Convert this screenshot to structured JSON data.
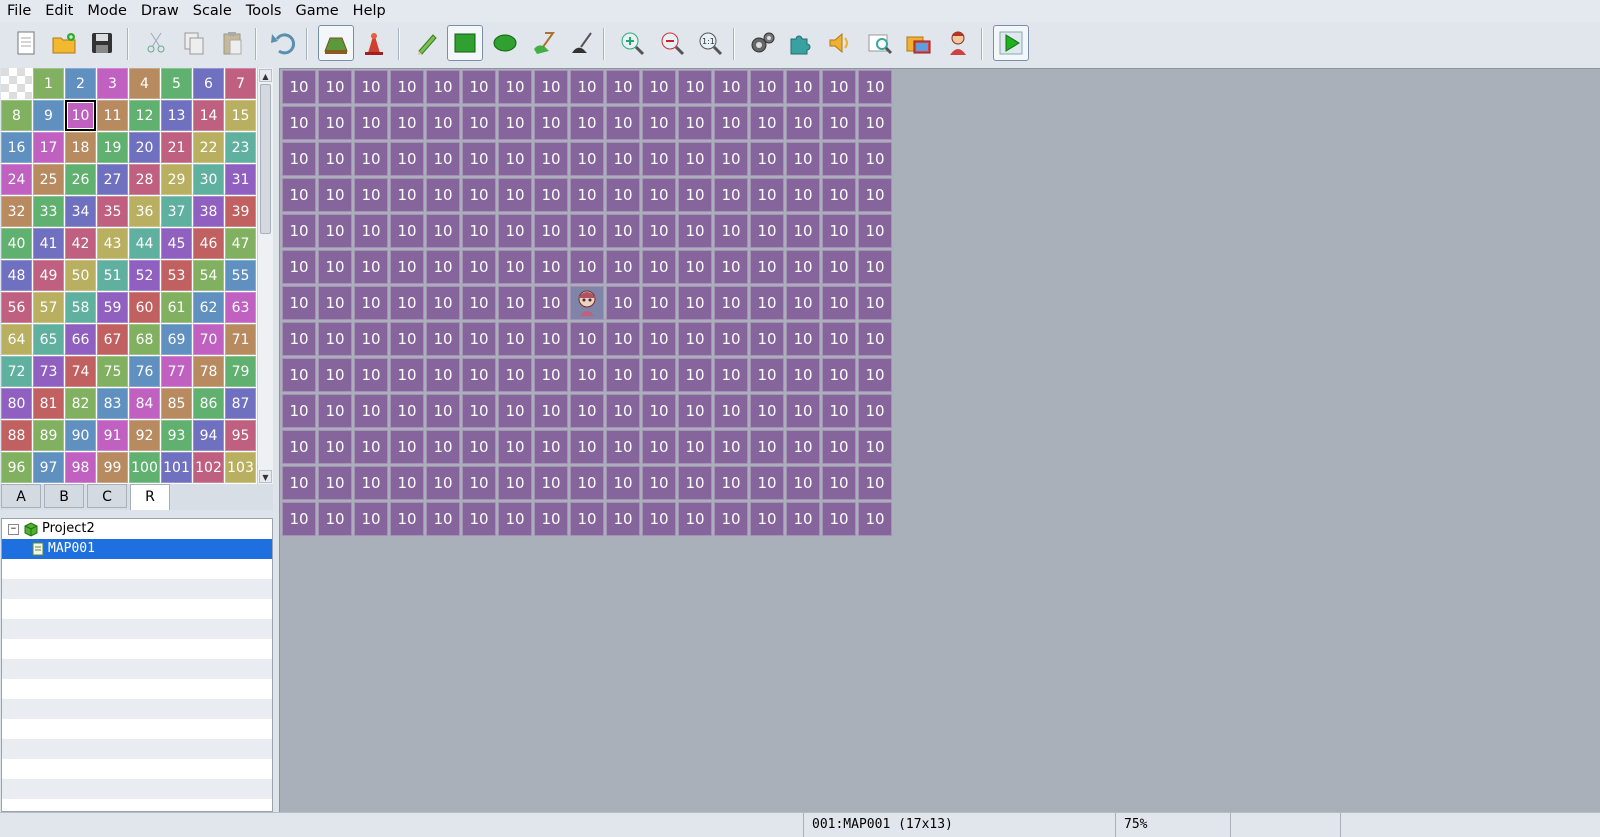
{
  "menu": [
    "File",
    "Edit",
    "Mode",
    "Draw",
    "Scale",
    "Tools",
    "Game",
    "Help"
  ],
  "toolbar": {
    "buttons": [
      {
        "name": "new-project-icon",
        "active": false
      },
      {
        "name": "open-project-icon",
        "active": false
      },
      {
        "name": "save-project-icon",
        "active": false
      },
      {
        "name": "cut-icon",
        "active": false
      },
      {
        "name": "copy-icon",
        "active": false
      },
      {
        "name": "paste-icon",
        "active": false
      },
      {
        "name": "undo-icon",
        "active": false
      },
      {
        "name": "map-mode-icon",
        "active": true
      },
      {
        "name": "event-mode-icon",
        "active": false
      },
      {
        "name": "pencil-icon",
        "active": false
      },
      {
        "name": "rectangle-icon",
        "active": true
      },
      {
        "name": "ellipse-icon",
        "active": false
      },
      {
        "name": "fill-icon",
        "active": false
      },
      {
        "name": "shadow-pen-icon",
        "active": false
      },
      {
        "name": "zoom-in-icon",
        "active": false
      },
      {
        "name": "zoom-out-icon",
        "active": false
      },
      {
        "name": "zoom-actual-icon",
        "active": false
      },
      {
        "name": "database-icon",
        "active": false
      },
      {
        "name": "plugin-manager-icon",
        "active": false
      },
      {
        "name": "sound-test-icon",
        "active": false
      },
      {
        "name": "event-search-icon",
        "active": false
      },
      {
        "name": "resource-manager-icon",
        "active": false
      },
      {
        "name": "character-generator-icon",
        "active": false
      },
      {
        "name": "playtest-icon",
        "active": true
      }
    ]
  },
  "palette": {
    "selected": 10,
    "tiles": [
      "1",
      "2",
      "3",
      "4",
      "5",
      "6",
      "7",
      "8",
      "9",
      "10",
      "11",
      "12",
      "13",
      "14",
      "15",
      "16",
      "17",
      "18",
      "19",
      "20",
      "21",
      "22",
      "23",
      "24",
      "25",
      "26",
      "27",
      "28",
      "29",
      "30",
      "31",
      "32",
      "33",
      "34",
      "35",
      "36",
      "37",
      "38",
      "39",
      "40",
      "41",
      "42",
      "43",
      "44",
      "45",
      "46",
      "47",
      "48",
      "49",
      "50",
      "51",
      "52",
      "53",
      "54",
      "55",
      "56",
      "57",
      "58",
      "59",
      "60",
      "61",
      "62",
      "63",
      "64",
      "65",
      "66",
      "67",
      "68",
      "69",
      "70",
      "71",
      "72",
      "73",
      "74",
      "75",
      "76",
      "77",
      "78",
      "79",
      "80",
      "81",
      "82",
      "83",
      "84",
      "85",
      "86",
      "87",
      "88",
      "89",
      "90",
      "91",
      "92",
      "93",
      "94",
      "95",
      "96",
      "97",
      "98",
      "99",
      "100",
      "101",
      "102",
      "103"
    ],
    "colors": [
      "#c06060",
      "#b88a60",
      "#b8b060",
      "#80b060",
      "#60b070",
      "#60b0a0",
      "#6090c0",
      "#7070c0",
      "#9060c0",
      "#c060c0",
      "#c06080"
    ],
    "tabs": [
      "A",
      "B",
      "C",
      "R"
    ],
    "active_tab": "R"
  },
  "tree": {
    "project": "Project2",
    "maps": [
      "MAP001"
    ],
    "selected_map": "MAP001"
  },
  "map": {
    "cols": 17,
    "rows": 13,
    "tile_value": "10",
    "event": {
      "col": 8,
      "row": 6
    }
  },
  "status": {
    "map_info": "001:MAP001 (17x13)",
    "zoom": "75%"
  }
}
